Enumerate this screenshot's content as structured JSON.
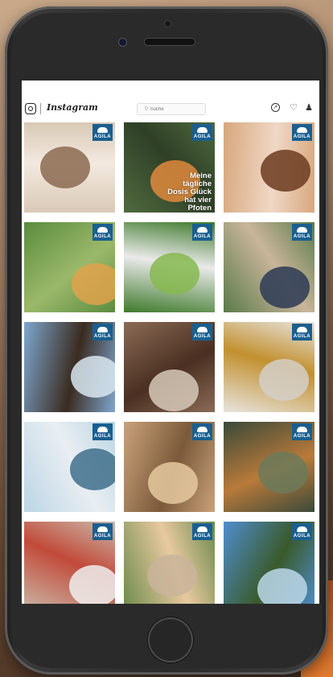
{
  "app": {
    "name": "Instagram"
  },
  "search": {
    "placeholder": "Suche"
  },
  "header_icons": [
    "instagram-camera-icon",
    "explore-compass-icon",
    "heart-icon",
    "profile-icon"
  ],
  "brand_badge": {
    "text": "AGILA",
    "color": "#1a5f8f"
  },
  "posts": [
    {
      "subject": "cat",
      "colors": [
        "#d9c9b6",
        "#8b6a50",
        "#f3e9df"
      ]
    },
    {
      "subject": "orange cat",
      "caption_lines": [
        "Meine",
        "tägliche",
        "Dosis Glück",
        "hat vier",
        "Pfoten"
      ],
      "colors": [
        "#4f6a3e",
        "#e08a3c",
        "#2f3f27"
      ]
    },
    {
      "subject": "dachshund",
      "colors": [
        "#d7a77d",
        "#6b3b20",
        "#f0d8c6"
      ]
    },
    {
      "subject": "dog",
      "colors": [
        "#5a8c3e",
        "#e0a24b",
        "#9bb86a"
      ]
    },
    {
      "subject": "cat in tree",
      "colors": [
        "#3f7a2c",
        "#86b94f",
        "#eaeaea"
      ]
    },
    {
      "subject": "man with cat",
      "colors": [
        "#5a7a4a",
        "#2b3a55",
        "#c9b59a"
      ]
    },
    {
      "subject": "dog and woman",
      "colors": [
        "#7fa8cf",
        "#d8e6f0",
        "#3a2b20"
      ]
    },
    {
      "subject": "woman with dog",
      "colors": [
        "#8a6b55",
        "#d7c9b8",
        "#4a2f22"
      ]
    },
    {
      "subject": "cat on stool",
      "colors": [
        "#e7e4df",
        "#d4cfc8",
        "#c2902e"
      ]
    },
    {
      "subject": "dogs at beach",
      "colors": [
        "#bcd5e4",
        "#3f6f8c",
        "#e9eef2"
      ]
    },
    {
      "subject": "cat on sand",
      "colors": [
        "#caa27a",
        "#e6c9a0",
        "#7a5a3a"
      ]
    },
    {
      "subject": "man with dog",
      "colors": [
        "#3a4a3a",
        "#6b7a5a",
        "#b97a3a"
      ]
    },
    {
      "subject": "cat with drink",
      "colors": [
        "#c9b9a8",
        "#eeeeee",
        "#c24a3a"
      ]
    },
    {
      "subject": "cat on bench",
      "colors": [
        "#6b8a4a",
        "#c9b49a",
        "#e8c9a0"
      ]
    },
    {
      "subject": "cyclists with dogs",
      "colors": [
        "#4f8ecf",
        "#bcd8ea",
        "#3a5a2a"
      ]
    }
  ]
}
